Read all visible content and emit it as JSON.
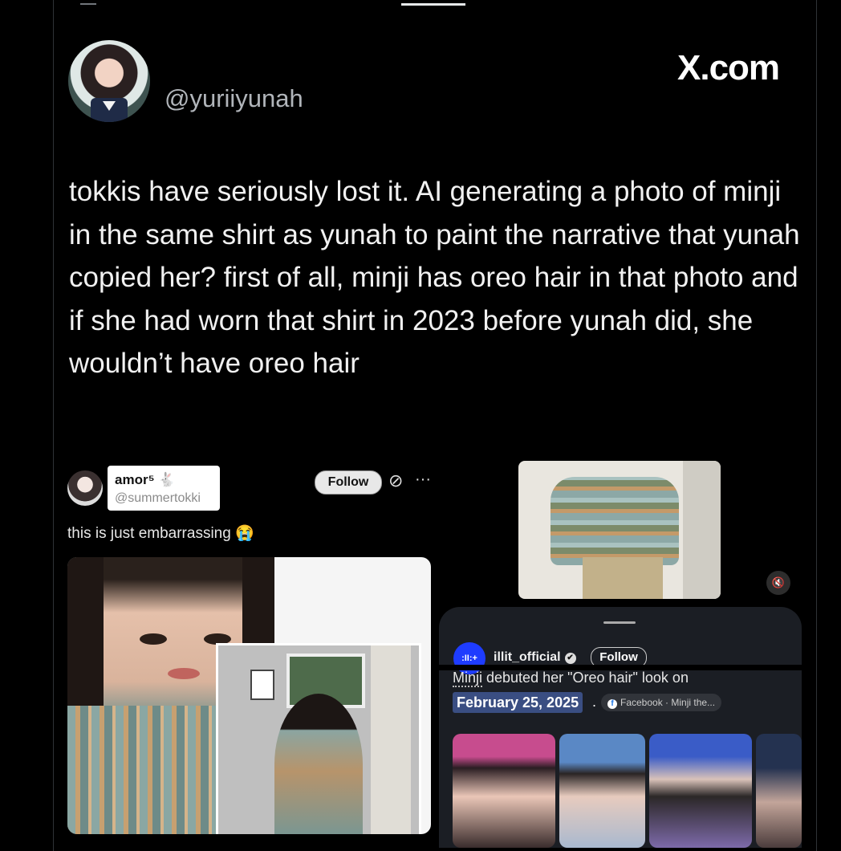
{
  "post": {
    "handle": "@yuriiyunah",
    "watermark": "X.com",
    "text": "tokkis have seriously lost it. AI generating a photo of minji in the same shirt as yunah to paint the narrative that yunah copied her? first of all, minji has oreo hair in that photo and if she had worn that shirt in 2023 before yunah did, she wouldn’t have oreo hair"
  },
  "quoted": {
    "name": "amor⁵ 🐇",
    "handle": "@summertokki",
    "follow_label": "Follow",
    "grok_icon": "⊘",
    "more_icon": "···",
    "text": "this is just embarrassing 😭"
  },
  "video": {
    "mute_icon": "🔇"
  },
  "card": {
    "account_logo": ":II:+",
    "account_name": "illit_official",
    "verified_icon": "✔",
    "follow_label": "Follow",
    "line_prefix": "Minji",
    "line_rest": " debuted her \"Oreo hair\" look on",
    "date": "February 25, 2025",
    "date_suffix": ".",
    "source_icon": "f",
    "source": "Facebook · Minji the..."
  }
}
